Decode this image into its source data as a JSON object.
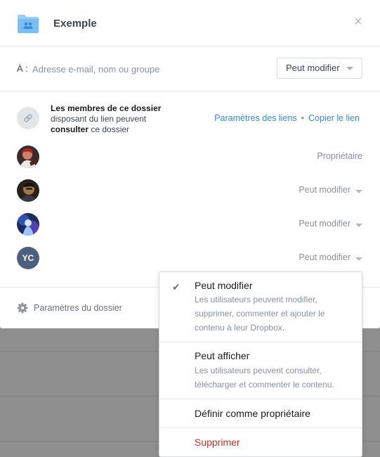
{
  "header": {
    "title": "Exemple",
    "close_symbol": "×",
    "folder_icon": "shared-folder-icon",
    "folder_color": "#92ceff"
  },
  "share": {
    "to_label": "À :",
    "placeholder": "Adresse e-mail, nom ou groupe",
    "permission": "Peut modifier"
  },
  "link_access": {
    "line1_bold": "Les membres de ce dossier",
    "line2": "disposant du lien peuvent",
    "line3_bold": "consulter",
    "line3_rest": " ce dossier",
    "settings_link": "Paramètres des liens",
    "separator": "•",
    "copy_link": "Copier le lien"
  },
  "members": [
    {
      "avatar": "photo",
      "role": "Propriétaire",
      "has_dropdown": false
    },
    {
      "avatar": "photo",
      "role": "Peut modifier",
      "has_dropdown": true
    },
    {
      "avatar": "photo",
      "role": "Peut modifier",
      "has_dropdown": true
    },
    {
      "avatar": "initials",
      "initials": "YC",
      "role": "Peut modifier",
      "has_dropdown": true
    }
  ],
  "footer": {
    "settings_label": "Paramètres du dossier"
  },
  "dropdown": {
    "items": [
      {
        "title": "Peut modifier",
        "description": "Les utilisateurs peuvent modifier, supprimer, commenter et ajouter le contenu à leur Dropbox.",
        "checked": true
      },
      {
        "title": "Peut afficher",
        "description": "Les utilisateurs peuvent consulter, télécharger et commenter le contenu.",
        "checked": false
      },
      {
        "title": "Définir comme propriétaire",
        "checked": false
      },
      {
        "title": "Supprimer",
        "checked": false,
        "danger": true
      }
    ],
    "check_symbol": "✔"
  },
  "colors": {
    "link": "#2d8be0",
    "danger": "#d9261c",
    "avatar_initials_bg": "#4c5f80"
  }
}
